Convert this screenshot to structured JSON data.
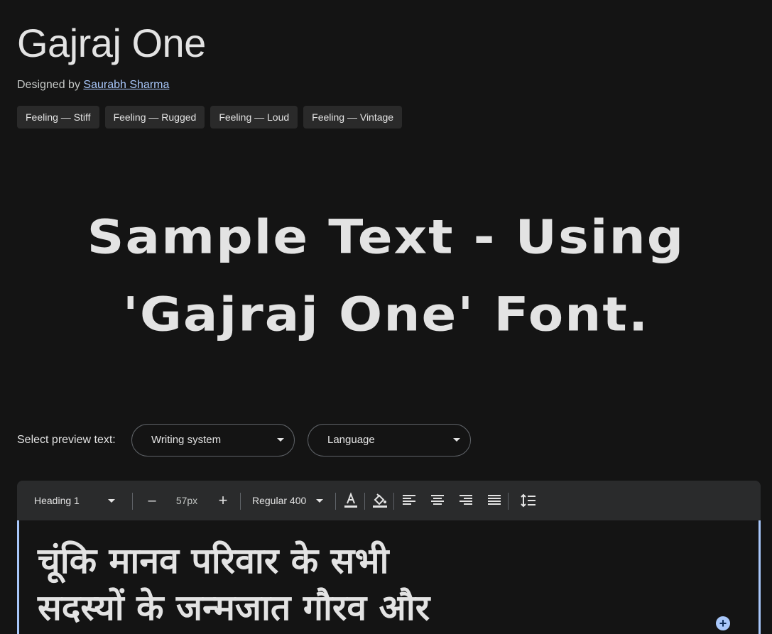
{
  "font": {
    "title": "Gajraj One",
    "designed_by_label": "Designed by",
    "designer_name": "Saurabh Sharma"
  },
  "tags": [
    "Feeling — Stiff",
    "Feeling — Rugged",
    "Feeling — Loud",
    "Feeling — Vintage"
  ],
  "sample": {
    "line1": "Sample Text - Using",
    "line2": "'Gajraj One' Font."
  },
  "preview": {
    "label": "Select preview text:",
    "writing_system": "Writing system",
    "language": "Language"
  },
  "toolbar": {
    "style": "Heading 1",
    "decrease": "–",
    "size": "57px",
    "increase": "+",
    "weight": "Regular 400",
    "icons": [
      "text-color-icon",
      "highlight-color-icon",
      "align-left-icon",
      "align-center-icon",
      "align-right-icon",
      "align-justify-icon",
      "line-height-icon"
    ]
  },
  "editor": {
    "line1": "चूंकि मानव परिवार के सभी",
    "line2": "सदस्यों के जन्मजात गौरव और"
  },
  "colors": {
    "background": "#141414",
    "text": "#e3e3e3",
    "link": "#a8c7fa",
    "chip": "#2a2a2a",
    "toolbar": "#2a2b2c",
    "accent": "#a8c7fa"
  }
}
